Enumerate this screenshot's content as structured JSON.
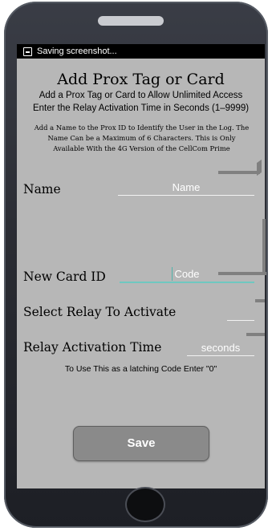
{
  "status_bar": {
    "icon": "screenshot-icon",
    "text": "Saving screenshot..."
  },
  "header": {
    "title": "Add Prox Tag or Card",
    "subtitle": "Add a Prox Tag or Card to Allow Unlimited Access",
    "relay_hint": "Enter the Relay Activation Time in Seconds (1–9999)",
    "note_lines": [
      "Add a Name to the Prox ID to Identify the User in the Log. The",
      "Name Can be a Maximum of 6 Characters. This is Only",
      "Available With the 4G Version of the CellCom Prime"
    ]
  },
  "form": {
    "name": {
      "label": "Name",
      "placeholder": "Name",
      "value": ""
    },
    "card_id": {
      "label": "New Card ID",
      "placeholder": "Code",
      "value": ""
    },
    "relay": {
      "label": "Select Relay To Activate",
      "value": ""
    },
    "time": {
      "label": "Relay Activation Time",
      "placeholder": "seconds",
      "value": ""
    }
  },
  "latch_note": "To Use This as a latching Code Enter \"0\"",
  "save_label": "Save",
  "colors": {
    "screen_bg": "#b7b7b7",
    "accent": "#6fc8c0",
    "button": "#8a8a8a"
  }
}
